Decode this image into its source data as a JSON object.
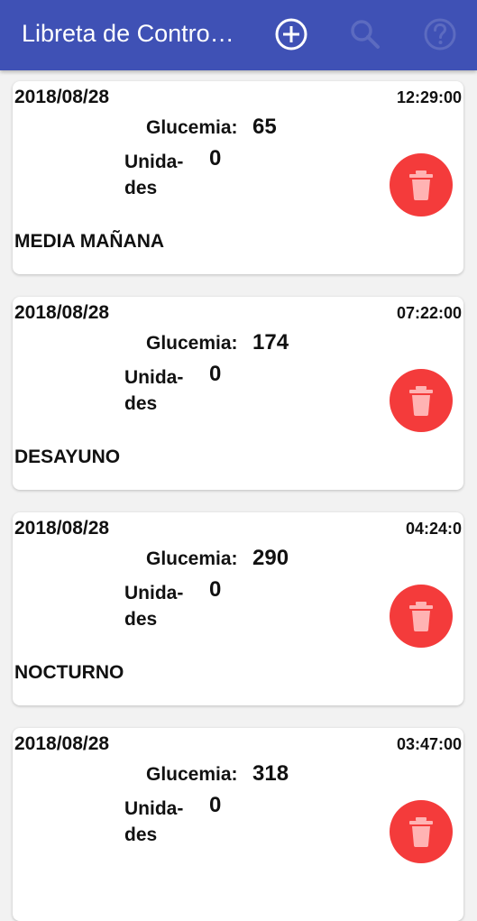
{
  "appbar": {
    "title": "Libreta de Contro…",
    "actions": [
      {
        "icon": "add-circle-icon"
      },
      {
        "icon": "search-icon"
      },
      {
        "icon": "help-circle-icon"
      }
    ]
  },
  "labels": {
    "glucemia": "Glucemia:",
    "unidades_line1": "Unida-",
    "unidades_line2": "des"
  },
  "entries": [
    {
      "date": "2018/08/28",
      "time": "12:29:00",
      "glucemia": "65",
      "unidades": "0",
      "meal": "MEDIA MAÑANA"
    },
    {
      "date": "2018/08/28",
      "time": "07:22:00",
      "glucemia": "174",
      "unidades": "0",
      "meal": "DESAYUNO"
    },
    {
      "date": "2018/08/28",
      "time": "04:24:0",
      "glucemia": "290",
      "unidades": "0",
      "meal": "NOCTURNO"
    },
    {
      "date": "2018/08/28",
      "time": "03:47:00",
      "glucemia": "318",
      "unidades": "0",
      "meal": ""
    }
  ],
  "colors": {
    "appbar": "#3f51b5",
    "delete_button": "#f43b3b",
    "background": "#f2f2f2"
  }
}
